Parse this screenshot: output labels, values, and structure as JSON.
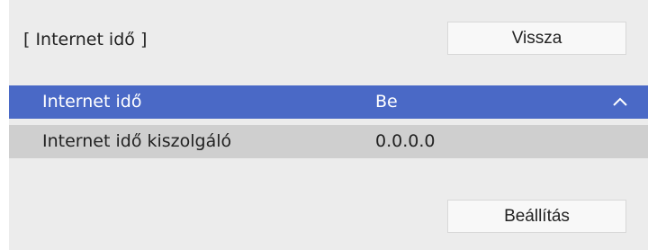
{
  "header": {
    "title": "[ Internet idő ]",
    "back_label": "Vissza"
  },
  "rows": [
    {
      "label": "Internet idő",
      "value": "Be",
      "selected": true,
      "icon": "chevron-up-icon"
    },
    {
      "label": "Internet idő kiszolgáló",
      "value": "0.0.0.0",
      "selected": false
    }
  ],
  "footer": {
    "settings_label": "Beállítás"
  },
  "colors": {
    "selected_row": "#4a69c6",
    "secondary_row": "#cfcfcf",
    "panel_bg": "#ececec"
  }
}
